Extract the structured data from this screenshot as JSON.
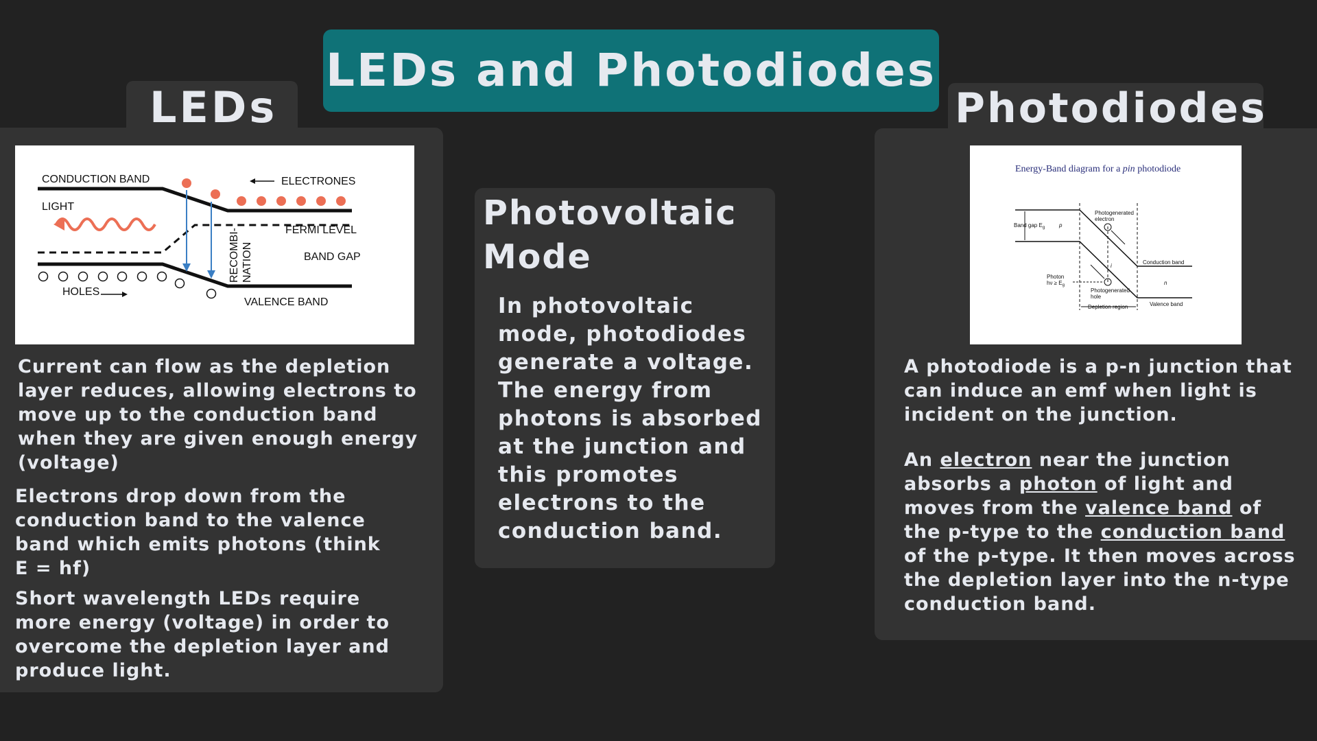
{
  "title": "LEDs and Photodiodes",
  "leds": {
    "heading": "LEDs",
    "paragraphs": [
      "Current can flow as the depletion layer reduces, allowing electrons to move up to the conduction band when they are given enough energy (voltage)",
      "Electrons drop down from the conduction band to the valence band which emits photons (think E = hf)",
      "Short wavelength LEDs require more energy (voltage) in order to overcome the depletion layer and produce light."
    ],
    "diagram": {
      "conduction_band": "CONDUCTION BAND",
      "electrones": "ELECTRONES",
      "light": "LIGHT",
      "fermi_level": "FERMI LEVEL",
      "band_gap": "BAND GAP",
      "recombi": "RECOMBI-",
      "nation": "NATION",
      "holes": "HOLES",
      "valence_band": "VALENCE BAND",
      "electron_color": "#ec6f55",
      "wave_color": "#ec6f55",
      "arrow_color": "#3b7fc4"
    }
  },
  "photovoltaic": {
    "heading_line1": "Photovoltaic",
    "heading_line2": "Mode",
    "text": "In photovoltaic mode, photodiodes generate a voltage. The energy from photons is absorbed at the junction and this promotes electrons to the conduction band."
  },
  "photodiodes": {
    "heading": "Photodiodes",
    "para1": "A photodiode is a p-n junction that can induce an emf when light is incident on the junction.",
    "para2": {
      "t1": "An ",
      "electron": "electron",
      "t2": " near the junction absorbs a ",
      "photon": "photon",
      "t3": " of light and moves from the ",
      "valence_band": "valence band",
      "t4": " of the p-type to the ",
      "conduction_band": "conduction band",
      "t5": " of the p-type. It then moves across the depletion layer into the n-type conduction band."
    },
    "diagram": {
      "title_pre": "Energy-Band diagram for a ",
      "title_italic": "pin",
      "title_post": " photodiode",
      "band_gap": "Band gap E",
      "band_gap_sub": "g",
      "p": "p",
      "i": "i",
      "n": "n",
      "photogen_electron_1": "Photogenerated",
      "photogen_electron_2": "electron",
      "conduction_band": "Conduction band",
      "valence_band": "Valence band",
      "photon_1": "Photon",
      "photon_2": "hν ≥ E",
      "photon_sub": "g",
      "photogen_hole_1": "Photogenerated",
      "photogen_hole_2": "hole",
      "depletion": "Depletion region",
      "title_color": "#2a2f7a"
    }
  },
  "colors": {
    "background": "#222222",
    "panel": "#333333",
    "title_bar": "#0f7277",
    "text": "#e6e9ef"
  }
}
